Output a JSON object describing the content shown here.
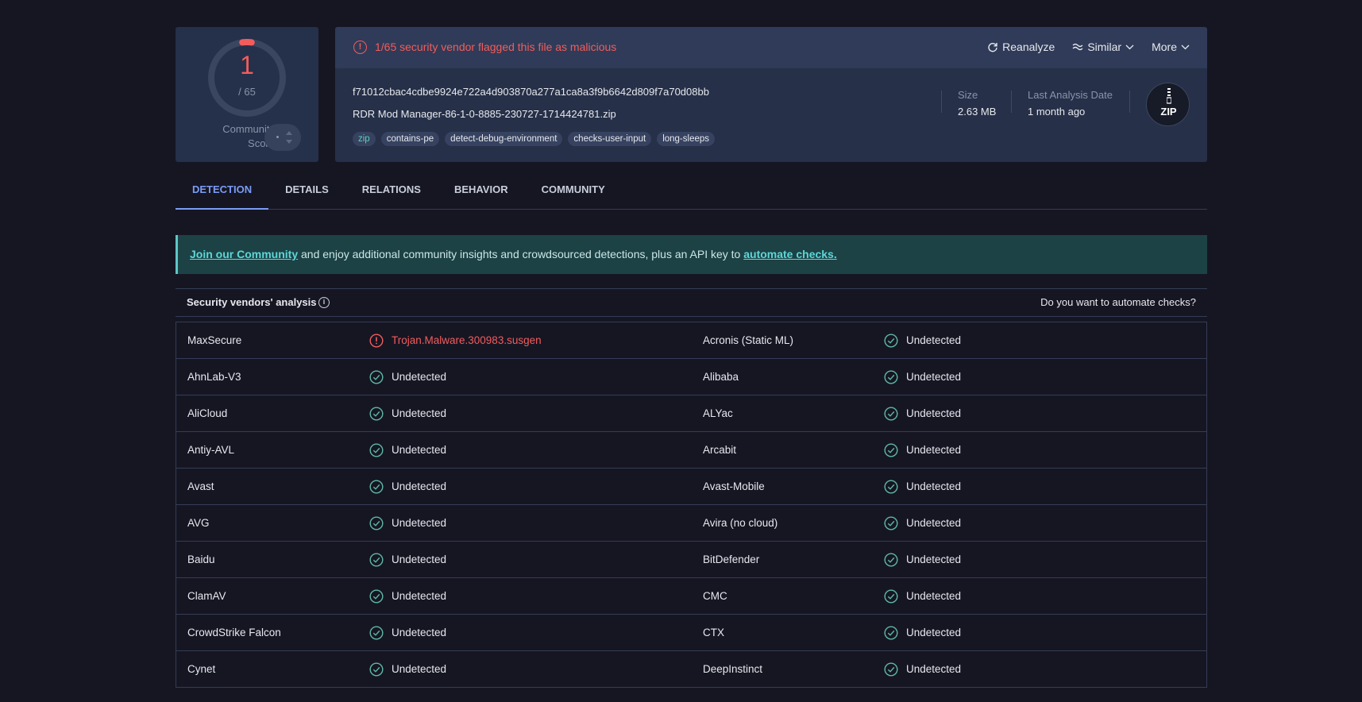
{
  "score": {
    "detections": "1",
    "total": "/ 65",
    "community_label": "Community\nScore"
  },
  "alert": {
    "text": "1/65 security vendor flagged this file as malicious"
  },
  "actions": {
    "reanalyze": "Reanalyze",
    "similar": "Similar",
    "more": "More"
  },
  "file": {
    "hash": "f71012cbac4cdbe9924e722a4d903870a277a1ca8a3f9b6642d809f7a70d08bb",
    "name": "RDR Mod Manager-86-1-0-8885-230727-1714424781.zip",
    "tags": [
      "zip",
      "contains-pe",
      "detect-debug-environment",
      "checks-user-input",
      "long-sleeps"
    ],
    "size_label": "Size",
    "size_value": "2.63 MB",
    "last_analysis_label": "Last Analysis Date",
    "last_analysis_value": "1 month ago",
    "type_badge": "ZIP"
  },
  "tabs": [
    "DETECTION",
    "DETAILS",
    "RELATIONS",
    "BEHAVIOR",
    "COMMUNITY"
  ],
  "banner": {
    "link1": "Join our Community",
    "middle": " and enjoy additional community insights and crowdsourced detections, plus an API key to ",
    "link2": "automate checks."
  },
  "vendors": {
    "title": "Security vendors' analysis",
    "automate_question": "Do you want to automate checks?",
    "rows": [
      [
        {
          "vendor": "MaxSecure",
          "result": "Trojan.Malware.300983.susgen",
          "malicious": true
        },
        {
          "vendor": "Acronis (Static ML)",
          "result": "Undetected",
          "malicious": false
        }
      ],
      [
        {
          "vendor": "AhnLab-V3",
          "result": "Undetected",
          "malicious": false
        },
        {
          "vendor": "Alibaba",
          "result": "Undetected",
          "malicious": false
        }
      ],
      [
        {
          "vendor": "AliCloud",
          "result": "Undetected",
          "malicious": false
        },
        {
          "vendor": "ALYac",
          "result": "Undetected",
          "malicious": false
        }
      ],
      [
        {
          "vendor": "Antiy-AVL",
          "result": "Undetected",
          "malicious": false
        },
        {
          "vendor": "Arcabit",
          "result": "Undetected",
          "malicious": false
        }
      ],
      [
        {
          "vendor": "Avast",
          "result": "Undetected",
          "malicious": false
        },
        {
          "vendor": "Avast-Mobile",
          "result": "Undetected",
          "malicious": false
        }
      ],
      [
        {
          "vendor": "AVG",
          "result": "Undetected",
          "malicious": false
        },
        {
          "vendor": "Avira (no cloud)",
          "result": "Undetected",
          "malicious": false
        }
      ],
      [
        {
          "vendor": "Baidu",
          "result": "Undetected",
          "malicious": false
        },
        {
          "vendor": "BitDefender",
          "result": "Undetected",
          "malicious": false
        }
      ],
      [
        {
          "vendor": "ClamAV",
          "result": "Undetected",
          "malicious": false
        },
        {
          "vendor": "CMC",
          "result": "Undetected",
          "malicious": false
        }
      ],
      [
        {
          "vendor": "CrowdStrike Falcon",
          "result": "Undetected",
          "malicious": false
        },
        {
          "vendor": "CTX",
          "result": "Undetected",
          "malicious": false
        }
      ],
      [
        {
          "vendor": "Cynet",
          "result": "Undetected",
          "malicious": false
        },
        {
          "vendor": "DeepInstinct",
          "result": "Undetected",
          "malicious": false
        }
      ]
    ]
  },
  "colors": {
    "malicious": "#f25c5c",
    "clean": "#5fb8a6",
    "accent": "#7a9cf5",
    "background": "#161623"
  }
}
